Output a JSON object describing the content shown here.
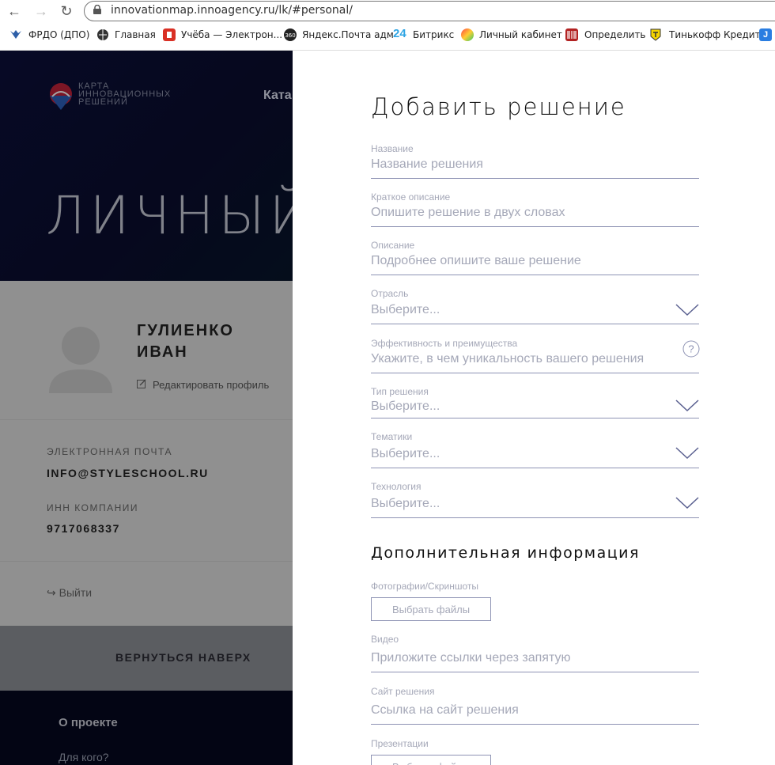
{
  "browser": {
    "url": "innovationmap.innoagency.ru/lk/#personal/",
    "bookmarks": [
      {
        "label": "ФРДО (ДПО)",
        "icon": "frdo-icon",
        "color": "#2d5fa8"
      },
      {
        "label": "Главная",
        "icon": "globe-icon",
        "color": "#333333"
      },
      {
        "label": "Учёба — Электрон...",
        "icon": "book-icon",
        "color": "#d93025"
      },
      {
        "label": "Яндекс.Почта адм",
        "icon": "yandex-360-icon",
        "color": "#222222"
      },
      {
        "label": "Битрикс",
        "icon": "bitrix24-icon",
        "color": "#2fa5e4"
      },
      {
        "label": "Личный кабинет",
        "icon": "circle-gradient-icon",
        "color": "#e8a020"
      },
      {
        "label": "Определить",
        "icon": "barcode-icon",
        "color": "#b22222"
      },
      {
        "label": "Тинькофф Кредит",
        "icon": "tinkoff-icon",
        "color": "#f5d400"
      }
    ]
  },
  "site": {
    "logo_lines": [
      "КАРТА",
      "ИННОВАЦИОННЫХ",
      "РЕШЕНИЙ"
    ],
    "nav_partial": "Ката",
    "hero_title": "ЛИЧНЫЙ",
    "user": {
      "first_line": "ГУЛИЕНКО",
      "second_line": "ИВАН"
    },
    "edit_profile": "Редактировать профиль",
    "email_label": "ЭЛЕКТРОННАЯ ПОЧТА",
    "email_value": "INFO@STYLESCHOOL.RU",
    "inn_label": "ИНН КОМПАНИИ",
    "inn_value": "9717068337",
    "logout": "Выйти",
    "back_to_top": "ВЕРНУТЬСЯ НАВЕРХ",
    "footer_heading": "О проекте",
    "footer_link": "Для кого?"
  },
  "modal": {
    "title": "Добавить решение",
    "fields": {
      "name": {
        "label": "Название",
        "placeholder": "Название решения"
      },
      "short": {
        "label": "Краткое описание",
        "placeholder": "Опишите решение в двух словах"
      },
      "desc": {
        "label": "Описание",
        "placeholder": "Подробнее опишите ваше решение"
      },
      "industry": {
        "label": "Отрасль",
        "placeholder": "Выберите..."
      },
      "efficiency": {
        "label": "Эффективность и преимущества",
        "placeholder": "Укажите, в чем уникальность вашего решения"
      },
      "type": {
        "label": "Тип решения",
        "placeholder": "Выберите..."
      },
      "topics": {
        "label": "Тематики",
        "placeholder": "Выберите..."
      },
      "tech": {
        "label": "Технология",
        "placeholder": "Выберите..."
      }
    },
    "section_additional": "Дополнительная информация",
    "photos": {
      "label": "Фотографии/Скриншоты",
      "button": "Выбрать файлы"
    },
    "video": {
      "label": "Видео",
      "placeholder": "Приложите ссылки через запятую"
    },
    "site": {
      "label": "Сайт решения",
      "placeholder": "Ссылка на сайт решения"
    },
    "presentations": {
      "label": "Презентации",
      "button": "Выбрать файлы"
    }
  }
}
